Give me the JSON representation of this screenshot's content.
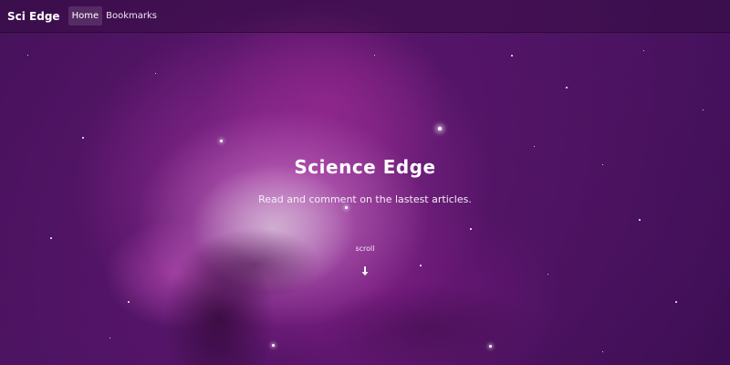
{
  "navbar": {
    "brand": "Sci Edge",
    "links": [
      {
        "label": "Home",
        "active": true
      },
      {
        "label": "Bookmarks",
        "active": false
      }
    ]
  },
  "hero": {
    "title": "Science Edge",
    "subtitle": "Read and comment on the lastest articles.",
    "scroll_label": "scroll",
    "scroll_icon": "arrow-down-icon"
  },
  "colors": {
    "background": "#3d0f52",
    "nebula_core": "#f0a0e6",
    "text": "#ffffff"
  }
}
